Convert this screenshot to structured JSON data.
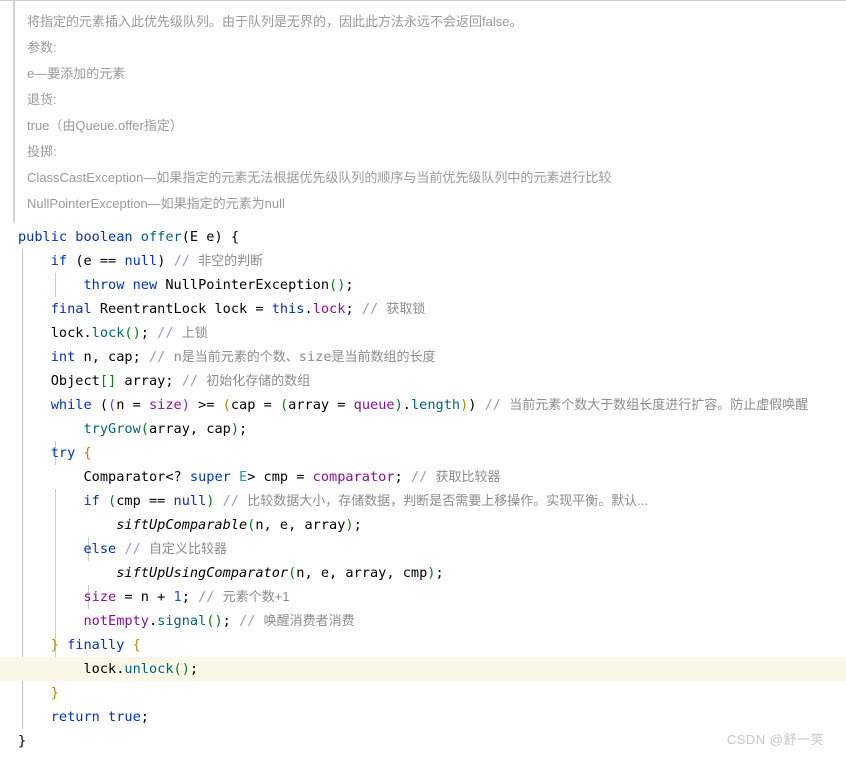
{
  "javadoc": {
    "lines": [
      "将指定的元素插入此优先级队列。由于队列是无界的，因此此方法永远不会返回false。",
      "参数:",
      "e—要添加的元素",
      "退货:",
      "true（由Queue.offer指定）",
      "投掷:",
      "ClassCastException—如果指定的元素无法根据优先级队列的顺序与当前优先级队列中的元素进行比较",
      "NullPointerException—如果指定的元素为null"
    ]
  },
  "code": {
    "language": "java",
    "highlighted_line_index": 17,
    "lines": [
      {
        "text": "public boolean offer(E e) {",
        "indent": 0
      },
      {
        "text": "    if (e == null) // 非空的判断",
        "indent": 1,
        "comment": "非空的判断"
      },
      {
        "text": "        throw new NullPointerException();",
        "indent": 2
      },
      {
        "text": "    final ReentrantLock lock = this.lock; // 获取锁",
        "indent": 1,
        "comment": "获取锁"
      },
      {
        "text": "    lock.lock(); // 上锁",
        "indent": 1,
        "comment": "上锁"
      },
      {
        "text": "    int n, cap; // n是当前元素的个数、size是当前数组的长度",
        "indent": 1,
        "comment": "n是当前元素的个数、size是当前数组的长度"
      },
      {
        "text": "    Object[] array; // 初始化存储的数组",
        "indent": 1,
        "comment": "初始化存储的数组"
      },
      {
        "text": "    while ((n = size) >= (cap = (array = queue).length)) // 当前元素个数大于数组长度进行扩容。防止虚假唤醒",
        "indent": 1,
        "comment": "当前元素个数大于数组长度进行扩容。防止虚假唤醒"
      },
      {
        "text": "        tryGrow(array, cap);",
        "indent": 2
      },
      {
        "text": "    try {",
        "indent": 1
      },
      {
        "text": "        Comparator<? super E> cmp = comparator; // 获取比较器",
        "indent": 2,
        "comment": "获取比较器"
      },
      {
        "text": "        if (cmp == null) // 比较数据大小，存储数据，判断是否需要上移操作。实现平衡。默认...",
        "indent": 2,
        "comment": "比较数据大小，存储数据，判断是否需要上移操作。实现平衡。默认..."
      },
      {
        "text": "            siftUpComparable(n, e, array);",
        "indent": 3
      },
      {
        "text": "        else // 自定义比较器",
        "indent": 2,
        "comment": "自定义比较器"
      },
      {
        "text": "            siftUpUsingComparator(n, e, array, cmp);",
        "indent": 3
      },
      {
        "text": "        size = n + 1; // 元素个数+1",
        "indent": 2,
        "comment": "元素个数+1"
      },
      {
        "text": "        notEmpty.signal(); // 唤醒消费者消费",
        "indent": 2,
        "comment": "唤醒消费者消费"
      },
      {
        "text": "    } finally {",
        "indent": 1
      },
      {
        "text": "        lock.unlock();",
        "indent": 2
      },
      {
        "text": "    }",
        "indent": 1
      },
      {
        "text": "    return true;",
        "indent": 1
      },
      {
        "text": "}",
        "indent": 0
      }
    ],
    "tokens": {
      "keywords": [
        "public",
        "boolean",
        "if",
        "throw",
        "new",
        "final",
        "int",
        "while",
        "try",
        "else",
        "finally",
        "return",
        "null",
        "true",
        "this",
        "super"
      ],
      "fields": [
        "size",
        "queue",
        "comparator",
        "notEmpty"
      ],
      "methods": [
        "offer",
        "lock",
        "unlock",
        "tryGrow",
        "length",
        "signal",
        "siftUpComparable",
        "siftUpUsingComparator"
      ],
      "types": [
        "NullPointerException",
        "ReentrantLock",
        "Object",
        "Comparator",
        "E"
      ]
    }
  },
  "watermark": {
    "text": "CSDN @舒一笑"
  },
  "colors": {
    "background": "#ffffff",
    "keyword": "#0033b3",
    "comment": "#8c8c8c",
    "field": "#871094",
    "number": "#1750eb",
    "string": "#067d17",
    "highlight_row": "#fbf8ea",
    "doc_text": "#9a9a9a",
    "watermark": "#c6c6c6"
  }
}
